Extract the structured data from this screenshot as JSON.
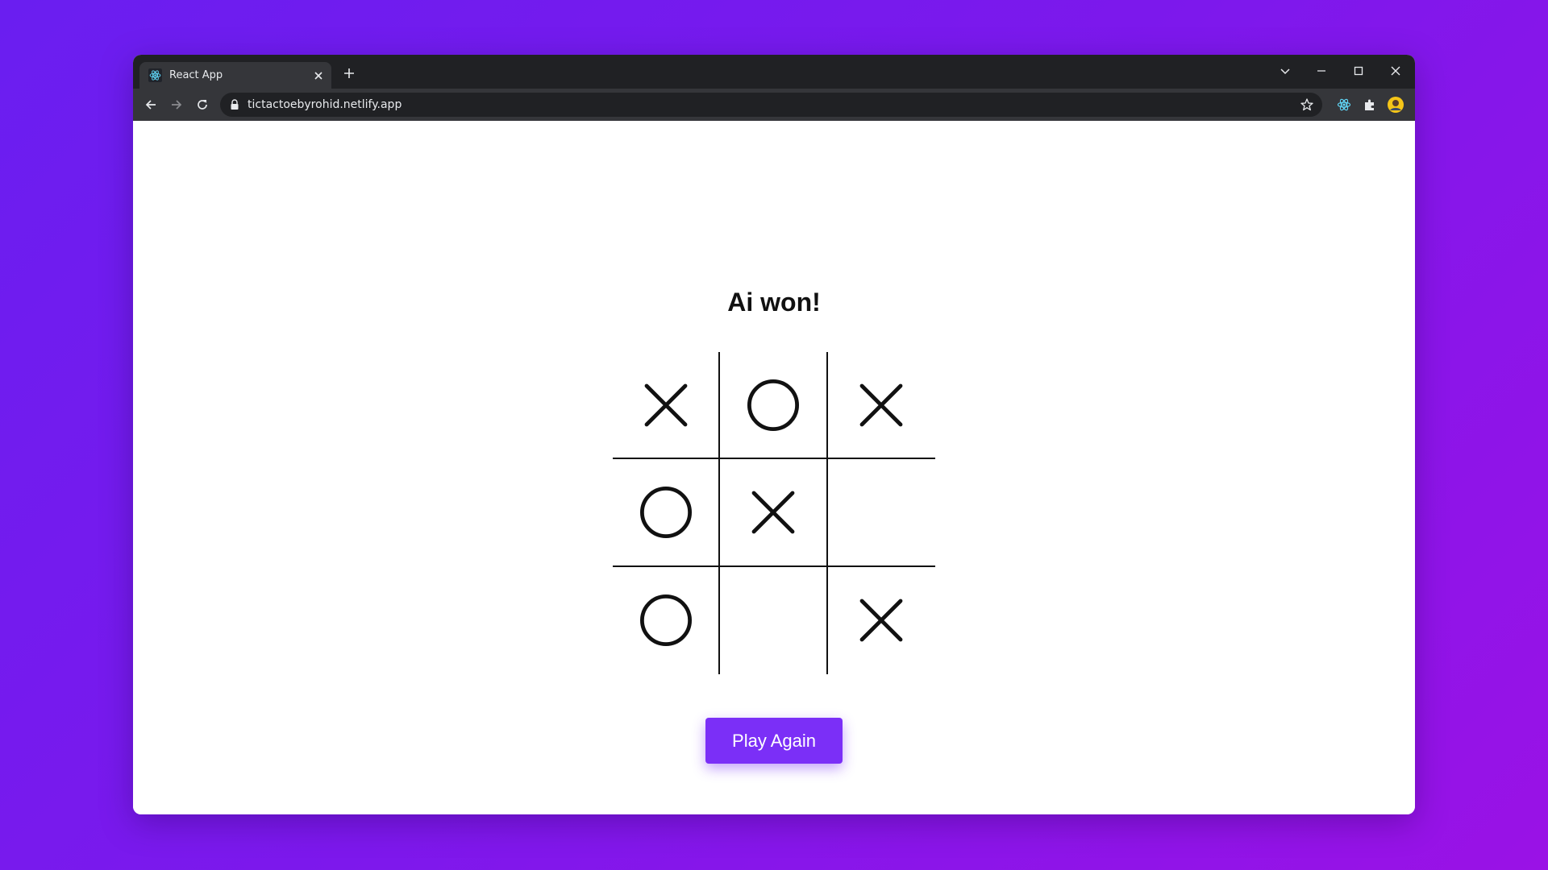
{
  "browser": {
    "tab_title": "React App",
    "url": "tictactoebyrohid.netlify.app"
  },
  "game": {
    "status": "Ai won!",
    "board": [
      [
        "X",
        "O",
        "X"
      ],
      [
        "O",
        "X",
        ""
      ],
      [
        "O",
        "",
        "X"
      ]
    ],
    "play_again_label": "Play Again"
  },
  "colors": {
    "background_gradient_start": "#6a1ef0",
    "background_gradient_end": "#9a12e6",
    "button": "#7b2ff7",
    "browser_frame": "#202124",
    "toolbar": "#35363a"
  }
}
